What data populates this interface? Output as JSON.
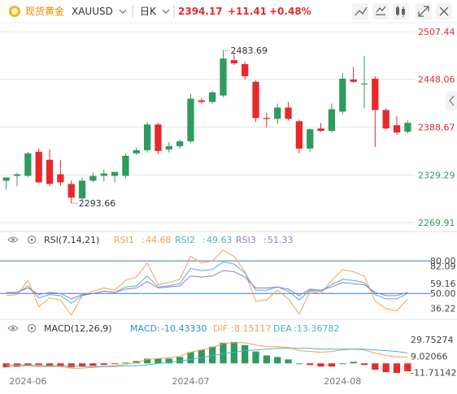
{
  "header": {
    "symbol_name": "现货黄金",
    "symbol_code": "XAUUSD",
    "interval": "日K",
    "price": "2394.17",
    "change": "+11.41",
    "change_pct": "+0.48%"
  },
  "toolbar_icons": [
    "chart-settings-icon",
    "candle-style-icon",
    "indicator-icon",
    "expand-icon",
    "close-icon"
  ],
  "colors": {
    "up": "#2e9b5f",
    "down": "#e8292b",
    "grid": "#e6e6e6",
    "text": "#333333",
    "axis_green": "#2e9b5f",
    "axis_red": "#e8292b",
    "rsi1": "#f5a04a",
    "rsi2": "#46b3d1",
    "rsi3": "#9b79c9",
    "macd": "#2d8fd6",
    "dif": "#f5a04a",
    "dea": "#46b3d1",
    "ref_line": "#3c78c8"
  },
  "chart_data": [
    {
      "type": "candlestick",
      "y_ticks": [
        "2507.44",
        "2448.06",
        "2388.67",
        "2329.29",
        "2269.91"
      ],
      "ylim": [
        2269.91,
        2507.44
      ],
      "x_ticks": [
        "2024-06",
        "2024-07",
        "2024-08"
      ],
      "annotations": [
        {
          "label": "2483.69",
          "index": 20
        },
        {
          "label": "2293.66",
          "index": 6
        }
      ],
      "candles": [
        {
          "o": 2322,
          "h": 2326,
          "l": 2311,
          "c": 2326
        },
        {
          "o": 2328,
          "h": 2332,
          "l": 2315,
          "c": 2330
        },
        {
          "o": 2328,
          "h": 2358,
          "l": 2326,
          "c": 2356
        },
        {
          "o": 2358,
          "h": 2362,
          "l": 2319,
          "c": 2320
        },
        {
          "o": 2348,
          "h": 2361,
          "l": 2315,
          "c": 2318
        },
        {
          "o": 2330,
          "h": 2348,
          "l": 2316,
          "c": 2320
        },
        {
          "o": 2318,
          "h": 2322,
          "l": 2294,
          "c": 2301
        },
        {
          "o": 2300,
          "h": 2326,
          "l": 2298,
          "c": 2322
        },
        {
          "o": 2322,
          "h": 2332,
          "l": 2320,
          "c": 2328
        },
        {
          "o": 2328,
          "h": 2336,
          "l": 2321,
          "c": 2331
        },
        {
          "o": 2328,
          "h": 2333,
          "l": 2320,
          "c": 2333
        },
        {
          "o": 2328,
          "h": 2356,
          "l": 2325,
          "c": 2353
        },
        {
          "o": 2356,
          "h": 2363,
          "l": 2354,
          "c": 2360
        },
        {
          "o": 2360,
          "h": 2395,
          "l": 2357,
          "c": 2392
        },
        {
          "o": 2392,
          "h": 2394,
          "l": 2355,
          "c": 2359
        },
        {
          "o": 2361,
          "h": 2370,
          "l": 2357,
          "c": 2365
        },
        {
          "o": 2365,
          "h": 2373,
          "l": 2362,
          "c": 2371
        },
        {
          "o": 2371,
          "h": 2430,
          "l": 2369,
          "c": 2424
        },
        {
          "o": 2422,
          "h": 2425,
          "l": 2418,
          "c": 2420
        },
        {
          "o": 2420,
          "h": 2434,
          "l": 2418,
          "c": 2432
        },
        {
          "o": 2428,
          "h": 2484,
          "l": 2426,
          "c": 2474
        },
        {
          "o": 2472,
          "h": 2481,
          "l": 2466,
          "c": 2468
        },
        {
          "o": 2467,
          "h": 2470,
          "l": 2448,
          "c": 2452
        },
        {
          "o": 2445,
          "h": 2447,
          "l": 2395,
          "c": 2400
        },
        {
          "o": 2400,
          "h": 2406,
          "l": 2388,
          "c": 2399
        },
        {
          "o": 2399,
          "h": 2418,
          "l": 2393,
          "c": 2413
        },
        {
          "o": 2413,
          "h": 2420,
          "l": 2397,
          "c": 2399
        },
        {
          "o": 2396,
          "h": 2398,
          "l": 2356,
          "c": 2362
        },
        {
          "o": 2362,
          "h": 2387,
          "l": 2358,
          "c": 2386
        },
        {
          "o": 2387,
          "h": 2394,
          "l": 2383,
          "c": 2384
        },
        {
          "o": 2384,
          "h": 2418,
          "l": 2382,
          "c": 2411
        },
        {
          "o": 2408,
          "h": 2456,
          "l": 2405,
          "c": 2449
        },
        {
          "o": 2448,
          "h": 2463,
          "l": 2444,
          "c": 2445
        },
        {
          "o": 2443,
          "h": 2477,
          "l": 2412,
          "c": 2443
        },
        {
          "o": 2449,
          "h": 2452,
          "l": 2364,
          "c": 2410
        },
        {
          "o": 2410,
          "h": 2412,
          "l": 2386,
          "c": 2387
        },
        {
          "o": 2391,
          "h": 2402,
          "l": 2379,
          "c": 2382
        },
        {
          "o": 2383,
          "h": 2397,
          "l": 2381,
          "c": 2394
        }
      ]
    },
    {
      "type": "line",
      "title": "RSI(7,14,21)",
      "series": [
        {
          "name": "RSI1",
          "value_label": "44.68",
          "values": [
            48,
            49,
            62,
            38,
            46,
            44,
            30,
            48,
            52,
            55,
            53,
            62,
            65,
            78,
            58,
            60,
            63,
            84,
            78,
            80,
            90,
            84,
            70,
            43,
            44,
            53,
            45,
            31,
            52,
            50,
            62,
            72,
            70,
            66,
            43,
            36,
            34,
            45
          ]
        },
        {
          "name": "RSI2",
          "value_label": "49.63",
          "values": [
            50,
            50,
            57,
            46,
            49,
            48,
            41,
            48,
            50,
            52,
            51,
            56,
            57,
            66,
            56,
            57,
            59,
            73,
            71,
            72,
            79,
            77,
            69,
            53,
            53,
            56,
            52,
            44,
            53,
            52,
            58,
            63,
            62,
            60,
            49,
            45,
            45,
            50
          ]
        },
        {
          "name": "RSI3",
          "value_label": "51.33",
          "values": [
            51,
            51,
            55,
            49,
            51,
            50,
            45,
            49,
            50,
            52,
            51,
            54,
            55,
            61,
            55,
            56,
            57,
            66,
            65,
            66,
            71,
            70,
            65,
            55,
            55,
            56,
            54,
            48,
            54,
            53,
            56,
            60,
            59,
            58,
            51,
            48,
            48,
            51
          ]
        }
      ],
      "y_ticks": [
        "80.00",
        "82.09",
        "59.16",
        "50.00",
        "36.22"
      ],
      "ylim": [
        30,
        92
      ],
      "ref_lines": [
        80,
        50
      ]
    },
    {
      "type": "bar",
      "title": "MACD(12,26,9)",
      "series": [
        {
          "name": "MACD",
          "value_label": "-10.43330",
          "values": [
            -5,
            -4,
            -3,
            -2,
            -3,
            -4,
            -5,
            -4,
            -3,
            -2,
            -1,
            1,
            3,
            6,
            6,
            6,
            8,
            14,
            17,
            21,
            26,
            27,
            23,
            15,
            10,
            8,
            5,
            0,
            -2,
            -4,
            -4,
            0,
            2,
            -2,
            -8,
            -11,
            -12,
            -10
          ]
        },
        {
          "name": "DIF",
          "value_label": "8.15117",
          "values": [
            -4,
            -4,
            -3,
            -4,
            -4,
            -4,
            -6,
            -6,
            -5,
            -4,
            -3,
            -1,
            1,
            5,
            6,
            7,
            9,
            14,
            17,
            20,
            25,
            26,
            26,
            23,
            21,
            21,
            20,
            16,
            15,
            14,
            15,
            17,
            18,
            17,
            13,
            10,
            8,
            8
          ]
        },
        {
          "name": "DEA",
          "value_label": "13.36782",
          "values": [
            -2,
            -2,
            -2,
            -3,
            -3,
            -3,
            -3,
            -4,
            -4,
            -4,
            -4,
            -3,
            -3,
            -2,
            0,
            1,
            3,
            5,
            7,
            10,
            12,
            14,
            16,
            17,
            18,
            19,
            19,
            19,
            19,
            18,
            18,
            18,
            18,
            18,
            17,
            16,
            15,
            13
          ]
        }
      ],
      "y_ticks": [
        "29.75274",
        "9.02066",
        "-11.71142"
      ],
      "ylim": [
        -13,
        32
      ]
    }
  ]
}
